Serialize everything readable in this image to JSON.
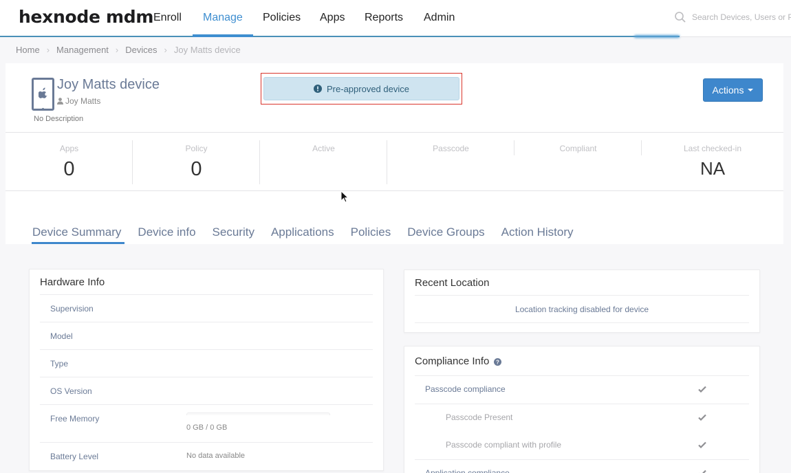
{
  "brand": {
    "logo": "hexnode mdm",
    "accent": "#3e87cc"
  },
  "nav": {
    "items": [
      {
        "label": "Enroll",
        "active": false
      },
      {
        "label": "Manage",
        "active": true
      },
      {
        "label": "Policies",
        "active": false
      },
      {
        "label": "Apps",
        "active": false
      },
      {
        "label": "Reports",
        "active": false
      },
      {
        "label": "Admin",
        "active": false
      }
    ],
    "search_placeholder": "Search Devices, Users or Policies"
  },
  "breadcrumb": [
    "Home",
    "Management",
    "Devices",
    "Joy Matts device"
  ],
  "device": {
    "name": "Joy Matts device",
    "owner": "Joy Matts",
    "description": "No Description",
    "platform_icon": "apple-icon",
    "status_banner": "Pre-approved device",
    "actions_label": "Actions"
  },
  "stats": [
    {
      "label": "Apps",
      "value": "0"
    },
    {
      "label": "Policy",
      "value": "0"
    },
    {
      "label": "Active",
      "value": ""
    },
    {
      "label": "Passcode",
      "value": ""
    },
    {
      "label": "Compliant",
      "value": ""
    },
    {
      "label": "Last checked-in",
      "value": "NA"
    }
  ],
  "tabs": [
    {
      "label": "Device Summary",
      "active": true
    },
    {
      "label": "Device info",
      "active": false
    },
    {
      "label": "Security",
      "active": false
    },
    {
      "label": "Applications",
      "active": false
    },
    {
      "label": "Policies",
      "active": false
    },
    {
      "label": "Device Groups",
      "active": false
    },
    {
      "label": "Action History",
      "active": false
    }
  ],
  "hardware_info": {
    "title": "Hardware Info",
    "rows": [
      {
        "label": "Supervision",
        "value": ""
      },
      {
        "label": "Model",
        "value": ""
      },
      {
        "label": "Type",
        "value": ""
      },
      {
        "label": "OS Version",
        "value": ""
      },
      {
        "label": "Free Memory",
        "value": "0 GB / 0 GB",
        "used_fraction": 0
      },
      {
        "label": "Battery Level",
        "value": "No data available"
      }
    ]
  },
  "recent_location": {
    "title": "Recent Location",
    "message": "Location tracking disabled for device"
  },
  "compliance_info": {
    "title": "Compliance Info",
    "rows": [
      {
        "label": "Passcode compliance",
        "status": "check",
        "level": 0
      },
      {
        "label": "Passcode Present",
        "status": "check",
        "level": 1
      },
      {
        "label": "Passcode compliant with profile",
        "status": "check",
        "level": 1
      },
      {
        "label": "Application compliance",
        "status": "check",
        "level": 0
      }
    ]
  }
}
